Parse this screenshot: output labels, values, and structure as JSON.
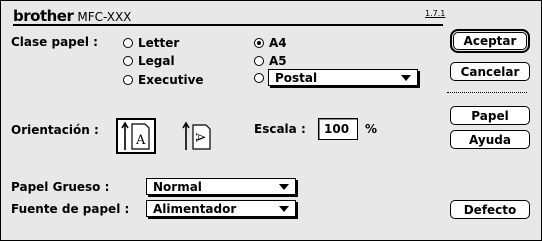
{
  "header": {
    "brand": "brother",
    "model": "MFC-XXX",
    "version": "1.7.1"
  },
  "paper_type": {
    "label": "Clase papel :",
    "options": [
      {
        "label": "Letter",
        "selected": false
      },
      {
        "label": "Legal",
        "selected": false
      },
      {
        "label": "Executive",
        "selected": false
      },
      {
        "label": "A4",
        "selected": true
      },
      {
        "label": "A5",
        "selected": false
      }
    ],
    "other_select": {
      "value": "Postal",
      "selected": false
    }
  },
  "orientation": {
    "label": "Orientación :",
    "options": [
      "portrait-icon",
      "landscape-icon"
    ],
    "selected": "portrait-icon"
  },
  "scale": {
    "label": "Escala :",
    "value": "100",
    "unit": "%"
  },
  "thick_paper": {
    "label": "Papel Grueso :",
    "value": "Normal"
  },
  "paper_source": {
    "label": "Fuente de papel :",
    "value": "Alimentador"
  },
  "buttons": {
    "accept": "Aceptar",
    "cancel": "Cancelar",
    "paper": "Papel",
    "help": "Ayuda",
    "default": "Defecto"
  }
}
